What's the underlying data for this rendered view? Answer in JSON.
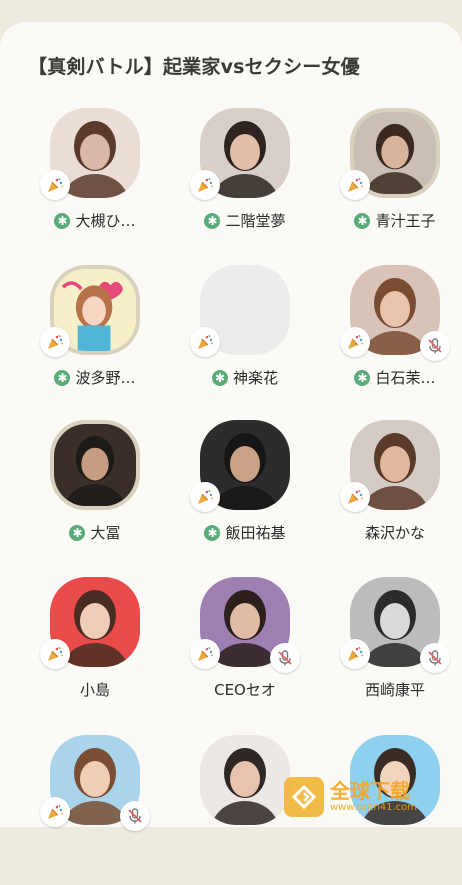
{
  "room": {
    "title": "【真剣バトル】起業家vsセクシー女優"
  },
  "colors": {
    "background": "#efeae0",
    "sheet": "#fbfaf7",
    "moderator_badge": "#5aab79",
    "speaker_ring": "#d8d1bd"
  },
  "speakers": [
    {
      "name": "大槻ひ…",
      "moderator": true,
      "ring": false,
      "party_badge": true,
      "muted": false,
      "photo": "portrait"
    },
    {
      "name": "二階堂夢",
      "moderator": true,
      "ring": false,
      "party_badge": true,
      "muted": false,
      "photo": "portrait"
    },
    {
      "name": "青汁王子",
      "moderator": true,
      "ring": true,
      "party_badge": true,
      "muted": false,
      "photo": "portrait"
    },
    {
      "name": "波多野…",
      "moderator": true,
      "ring": true,
      "party_badge": true,
      "muted": false,
      "photo": "illustration"
    },
    {
      "name": "神楽花",
      "moderator": true,
      "ring": false,
      "party_badge": true,
      "muted": false,
      "photo": "empty"
    },
    {
      "name": "白石茉…",
      "moderator": true,
      "ring": false,
      "party_badge": true,
      "muted": true,
      "photo": "portrait"
    },
    {
      "name": "大冨",
      "moderator": true,
      "ring": true,
      "party_badge": false,
      "muted": false,
      "photo": "portrait"
    },
    {
      "name": "飯田祐基",
      "moderator": true,
      "ring": false,
      "party_badge": true,
      "muted": false,
      "photo": "portrait"
    },
    {
      "name": "森沢かな",
      "moderator": false,
      "ring": false,
      "party_badge": true,
      "muted": false,
      "photo": "portrait"
    },
    {
      "name": "小島",
      "moderator": false,
      "ring": false,
      "party_badge": true,
      "muted": false,
      "photo": "portrait"
    },
    {
      "name": "CEOセオ",
      "moderator": false,
      "ring": false,
      "party_badge": true,
      "muted": true,
      "photo": "portrait"
    },
    {
      "name": "西崎康平",
      "moderator": false,
      "ring": false,
      "party_badge": true,
      "muted": true,
      "photo": "portrait"
    },
    {
      "name": "",
      "moderator": false,
      "ring": false,
      "party_badge": true,
      "muted": true,
      "photo": "portrait"
    },
    {
      "name": "",
      "moderator": false,
      "ring": false,
      "party_badge": false,
      "muted": false,
      "photo": "portrait"
    },
    {
      "name": "",
      "moderator": false,
      "ring": false,
      "party_badge": false,
      "muted": false,
      "photo": "portrait"
    }
  ],
  "moderator_mark": "✱",
  "watermark": {
    "text": "全球下载",
    "url": "www.qqtn41.com"
  }
}
